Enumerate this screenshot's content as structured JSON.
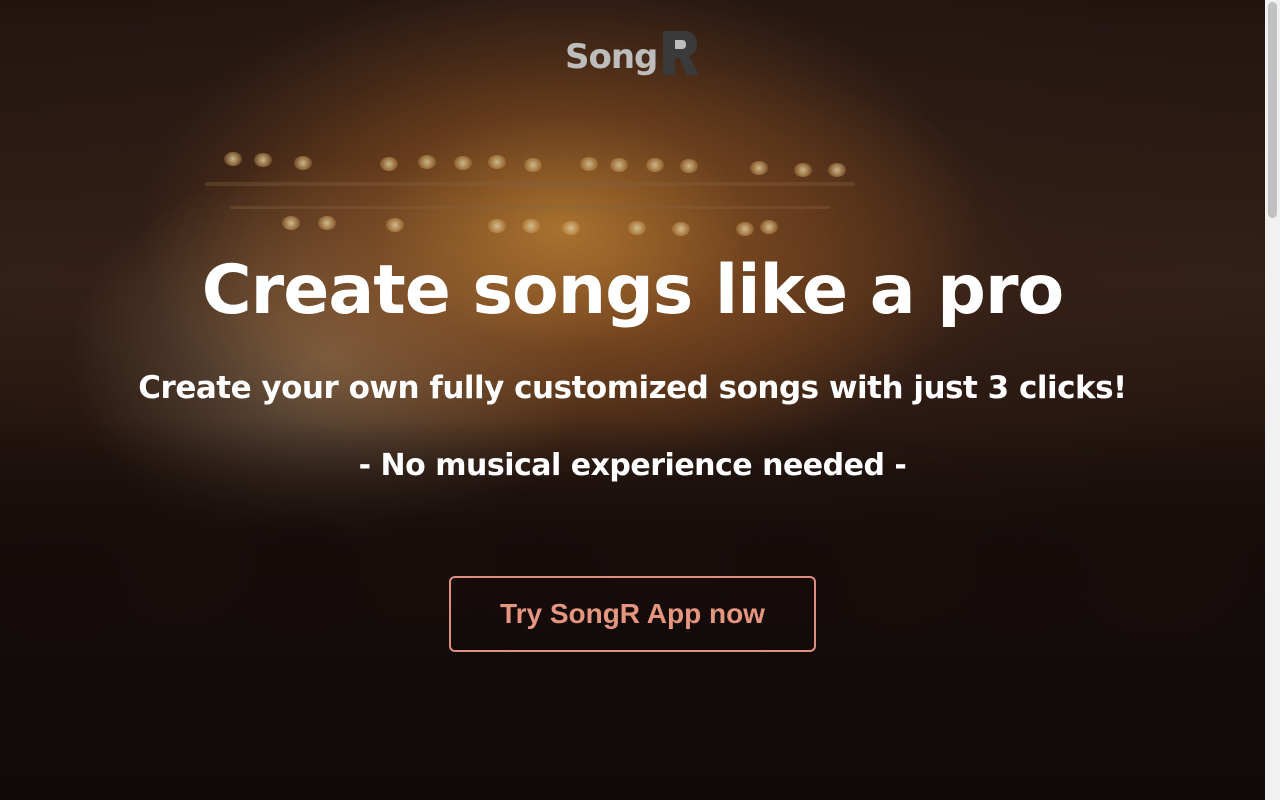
{
  "header": {
    "logo_text": "Song",
    "logo_mark_letter": "R"
  },
  "hero": {
    "headline": "Create songs like a pro",
    "subline": "Create your own fully customized songs with just 3 clicks!",
    "tagline": "- No musical experience needed -",
    "cta_label": "Try SongR App now"
  },
  "colors": {
    "accent": "#e6957f",
    "accent_border": "#e08f7e",
    "text": "#ffffff",
    "logo_gray": "#bdbdbd",
    "logo_mark_dark": "#3a3a3a"
  },
  "icons": [
    "songr-logo-mark"
  ]
}
